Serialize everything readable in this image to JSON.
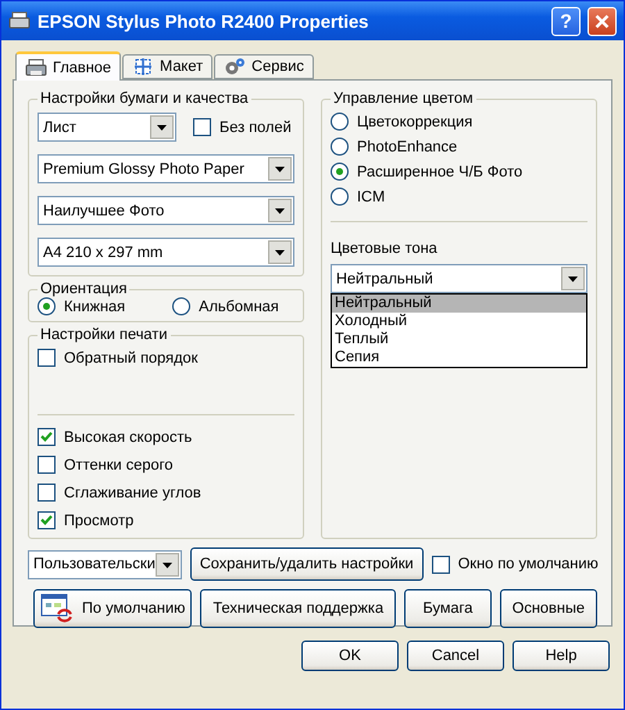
{
  "window": {
    "title": "EPSON Stylus Photo R2400 Properties",
    "help": "?"
  },
  "tabs": [
    {
      "label": "Главное",
      "selected": true,
      "kind": "printer"
    },
    {
      "label": "Макет",
      "selected": false,
      "kind": "layout"
    },
    {
      "label": "Сервис",
      "selected": false,
      "kind": "service"
    }
  ],
  "paper_quality": {
    "title": "Настройки бумаги и качества",
    "source": "Лист",
    "borderless": {
      "label": "Без полей",
      "checked": false
    },
    "media": "Premium Glossy Photo Paper",
    "quality": "Наилучшее Фото",
    "size": "A4 210 x 297 mm"
  },
  "orientation": {
    "title": "Ориентация",
    "options": [
      {
        "label": "Книжная",
        "selected": true
      },
      {
        "label": "Альбомная",
        "selected": false
      }
    ]
  },
  "print_settings": {
    "title": "Настройки печати",
    "order_options": [
      {
        "label": "Обратный порядок",
        "checked": false
      }
    ],
    "quality_options": [
      {
        "label": "Высокая скорость",
        "checked": true
      },
      {
        "label": "Оттенки серого",
        "checked": false
      },
      {
        "label": "Сглаживание углов",
        "checked": false
      },
      {
        "label": "Просмотр",
        "checked": true
      }
    ]
  },
  "color_management": {
    "title": "Управление цветом",
    "modes": [
      {
        "label": "Цветокоррекция",
        "selected": false
      },
      {
        "label": "PhotoEnhance",
        "selected": false
      },
      {
        "label": "Расширенное Ч/Б Фото",
        "selected": true
      },
      {
        "label": "ICM",
        "selected": false
      }
    ],
    "tone": {
      "label": "Цветовые тона",
      "value": "Нейтральный",
      "expanded": true,
      "options": [
        {
          "label": "Нейтральный",
          "selected": true
        },
        {
          "label": "Холодный",
          "selected": false
        },
        {
          "label": "Теплый",
          "selected": false
        },
        {
          "label": "Сепия",
          "selected": false
        }
      ]
    }
  },
  "presets": {
    "value": "Пользовательски",
    "save_button": "Сохранить/удалить настройки",
    "default_window": {
      "label": "Окно по умолчанию",
      "checked": false
    }
  },
  "actions": [
    {
      "label": "По умолчанию",
      "kind": "icon"
    },
    {
      "label": "Техническая поддержка",
      "kind": "plain"
    },
    {
      "label": "Бумага",
      "kind": "plain"
    },
    {
      "label": "Основные",
      "kind": "plain"
    }
  ],
  "buttons": [
    "OK",
    "Cancel",
    "Help"
  ]
}
